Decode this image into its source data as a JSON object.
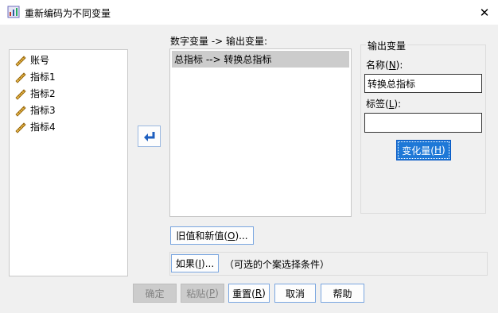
{
  "window": {
    "title": "重新编码为不同变量",
    "close_glyph": "✕"
  },
  "variables": [
    {
      "label": "账号"
    },
    {
      "label": "指标1"
    },
    {
      "label": "指标2"
    },
    {
      "label": "指标3"
    },
    {
      "label": "指标4"
    }
  ],
  "mapping": {
    "label": "数字变量 -> 输出变量:",
    "items": [
      {
        "text": "总指标 --> 转换总指标"
      }
    ]
  },
  "output": {
    "legend": "输出变量",
    "name_label_pre": "名称(",
    "name_label_key": "N",
    "name_label_post": "):",
    "name_value": "转换总指标",
    "label_label_pre": "标签(",
    "label_label_key": "L",
    "label_label_post": "):",
    "label_value": "",
    "change_pre": "变化量(",
    "change_key": "H",
    "change_post": ")"
  },
  "buttons": {
    "oldnew_pre": "旧值和新值(",
    "oldnew_key": "O",
    "oldnew_post": ")...",
    "if_pre": "如果(",
    "if_key": "I",
    "if_post": ")...",
    "if_desc": "（可选的个案选择条件）",
    "ok": "确定",
    "paste_pre": "粘贴(",
    "paste_key": "P",
    "paste_post": ")",
    "reset_pre": "重置(",
    "reset_key": "R",
    "reset_post": ")",
    "cancel": "取消",
    "help": "帮助"
  },
  "colors": {
    "accent": "#1e78d7",
    "selection": "#cccccc",
    "disabled": "#cccccc"
  },
  "icons": {
    "variable": "ruler-scale-icon",
    "move": "return-arrow-icon",
    "app": "spss-app-icon"
  }
}
